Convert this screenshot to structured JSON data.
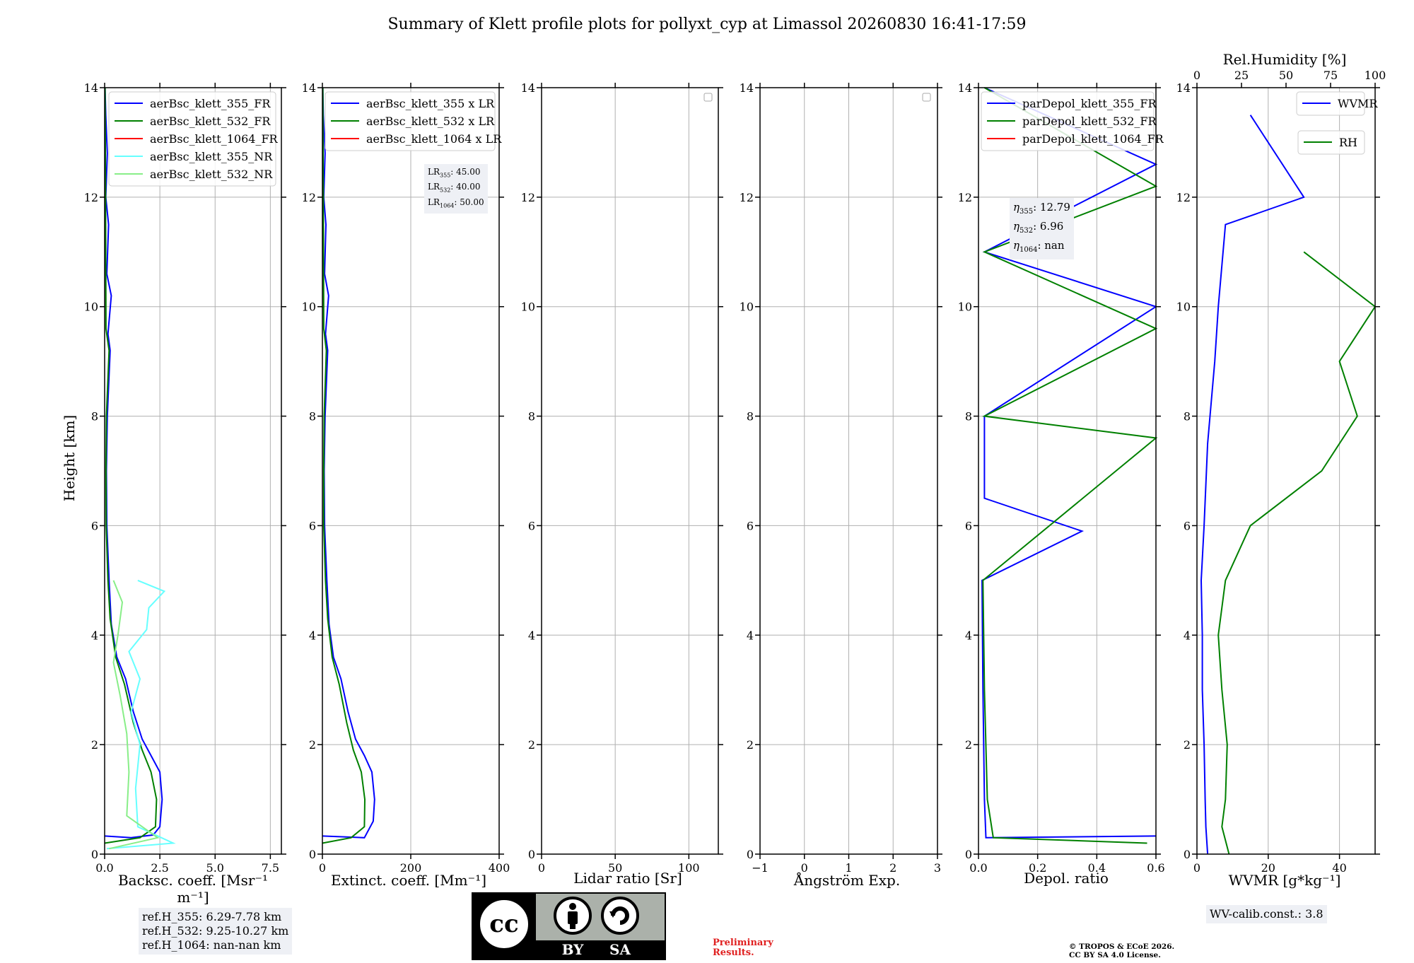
{
  "title": "Summary of Klett profile plots for pollyxt_cyp at Limassol 20260830 16:41-17:59",
  "ylabel": "Height [km]",
  "yticks": [
    "0",
    "2",
    "4",
    "6",
    "8",
    "10",
    "12",
    "14"
  ],
  "ylim": [
    0,
    14
  ],
  "colors": {
    "c355": "#0000ff",
    "c532": "#008000",
    "c1064": "#ff0000",
    "c355nr": "#66ffff",
    "c532nr": "#88ee88"
  },
  "panels": {
    "backscatter": {
      "xlabel": "Backsc. coeff. [Msr⁻¹ m⁻¹]",
      "xticks": [
        "0.0",
        "2.5",
        "5.0",
        "7.5"
      ],
      "xlim": [
        0,
        8
      ],
      "legend": [
        "aerBsc_klett_355_FR",
        "aerBsc_klett_532_FR",
        "aerBsc_klett_1064_FR",
        "aerBsc_klett_355_NR",
        "aerBsc_klett_532_NR"
      ]
    },
    "extinction": {
      "xlabel": "Extinct. coeff. [Mm⁻¹]",
      "xticks": [
        "0",
        "200",
        "400"
      ],
      "xlim": [
        0,
        400
      ],
      "legend": [
        "aerBsc_klett_355 x LR",
        "aerBsc_klett_532 x LR",
        "aerBsc_klett_1064 x LR"
      ],
      "lr_text": [
        "LR355: 45.00",
        "LR532: 40.00",
        "LR1064: 50.00"
      ]
    },
    "lidar_ratio": {
      "xlabel": "Lidar ratio [Sr]",
      "xticks": [
        "0",
        "50",
        "100"
      ],
      "xlim": [
        0,
        120
      ]
    },
    "angstrom": {
      "xlabel": "Ångström Exp.",
      "xticks": [
        "−1",
        "0",
        "1",
        "2",
        "3"
      ],
      "xlim": [
        -1,
        3
      ]
    },
    "depol": {
      "xlabel": "Depol. ratio",
      "xticks": [
        "0.0",
        "0.2",
        "0.4",
        "0.6"
      ],
      "xlim": [
        0,
        0.6
      ],
      "legend": [
        "parDepol_klett_355_FR",
        "parDepol_klett_532_FR",
        "parDepol_klett_1064_FR"
      ],
      "eta_text": [
        "η355: 12.79",
        "η532: 6.96",
        "η1064: nan"
      ]
    },
    "wvmr": {
      "xlabel": "WVMR [g*kg⁻¹]",
      "xticks": [
        "0",
        "20",
        "40"
      ],
      "xlim": [
        0,
        50
      ],
      "top_label": "Rel.Humidity [%]",
      "top_ticks": [
        "0",
        "25",
        "50",
        "75",
        "100"
      ],
      "top_lim": [
        0,
        100
      ],
      "legend_wvmr": "WVMR",
      "legend_rh": "RH"
    }
  },
  "ref_heights": [
    "ref.H_355: 6.29-7.78 km",
    "ref.H_532: 9.25-10.27 km",
    "ref.H_1064: nan-nan km"
  ],
  "wv_calib": "WV-calib.const.: 3.8",
  "preliminary": [
    "Preliminary",
    "Results."
  ],
  "copyright": [
    "© TROPOS & ECoE 2026.",
    "CC BY SA 4.0 License."
  ],
  "license_badge": {
    "by": "BY",
    "sa": "SA"
  },
  "chart_data": {
    "type": "line",
    "title": "Summary of Klett profile plots for pollyxt_cyp at Limassol 20260830 16:41-17:59",
    "ylabel": "Height [km]",
    "ylim": [
      0,
      14
    ],
    "grid": true,
    "profiles": {
      "backscatter": {
        "xlim": [
          0,
          8
        ],
        "series": [
          {
            "name": "aerBsc_klett_355_FR",
            "color": "#0000ff",
            "points": [
              [
                0,
                0.33
              ],
              [
                1.2,
                0.3
              ],
              [
                2.2,
                0.35
              ],
              [
                2.5,
                0.5
              ],
              [
                2.6,
                1.0
              ],
              [
                2.5,
                1.5
              ],
              [
                2.1,
                1.8
              ],
              [
                1.7,
                2.1
              ],
              [
                1.3,
                2.6
              ],
              [
                0.95,
                3.2
              ],
              [
                0.55,
                3.6
              ],
              [
                0.3,
                4.2
              ],
              [
                0.2,
                5
              ],
              [
                0.1,
                6
              ],
              [
                0.08,
                7
              ],
              [
                0.12,
                8
              ],
              [
                0.25,
                9.2
              ],
              [
                0.15,
                9.5
              ],
              [
                0.3,
                10.2
              ],
              [
                0.1,
                10.6
              ],
              [
                0.18,
                11.5
              ],
              [
                0.05,
                12
              ],
              [
                0.12,
                12.8
              ],
              [
                0.05,
                13.5
              ],
              [
                0.02,
                14
              ]
            ]
          },
          {
            "name": "aerBsc_klett_532_FR",
            "color": "#008000",
            "points": [
              [
                0,
                0.2
              ],
              [
                1.6,
                0.3
              ],
              [
                2.3,
                0.5
              ],
              [
                2.35,
                1.0
              ],
              [
                2.1,
                1.5
              ],
              [
                1.7,
                1.9
              ],
              [
                1.3,
                2.4
              ],
              [
                0.9,
                3.1
              ],
              [
                0.5,
                3.6
              ],
              [
                0.25,
                4.3
              ],
              [
                0.15,
                5
              ],
              [
                0.07,
                6
              ],
              [
                0.06,
                7
              ],
              [
                0.08,
                8
              ],
              [
                0.2,
                9.2
              ],
              [
                0.06,
                9.6
              ],
              [
                0.04,
                12
              ],
              [
                0.02,
                14
              ]
            ]
          },
          {
            "name": "aerBsc_klett_355_NR",
            "color": "#66ffff",
            "points": [
              [
                0.1,
                0.1
              ],
              [
                3.1,
                0.2
              ],
              [
                1.5,
                0.5
              ],
              [
                1.4,
                1.2
              ],
              [
                1.6,
                2.0
              ],
              [
                1.2,
                2.6
              ],
              [
                1.6,
                3.2
              ],
              [
                1.1,
                3.7
              ],
              [
                1.9,
                4.1
              ],
              [
                2.0,
                4.5
              ],
              [
                2.7,
                4.8
              ],
              [
                1.5,
                5.0
              ]
            ]
          },
          {
            "name": "aerBsc_klett_532_NR",
            "color": "#88ee88",
            "points": [
              [
                0.2,
                0.1
              ],
              [
                2.4,
                0.3
              ],
              [
                1.0,
                0.7
              ],
              [
                1.1,
                1.5
              ],
              [
                1.0,
                2.2
              ],
              [
                0.7,
                2.9
              ],
              [
                0.4,
                3.5
              ],
              [
                0.6,
                4.0
              ],
              [
                0.8,
                4.6
              ],
              [
                0.4,
                5.0
              ]
            ]
          }
        ]
      },
      "extinction": {
        "xlim": [
          0,
          400
        ],
        "series": [
          {
            "name": "aerBsc_klett_355 x LR",
            "color": "#0000ff",
            "points": [
              [
                0,
                0.33
              ],
              [
                95,
                0.3
              ],
              [
                115,
                0.6
              ],
              [
                118,
                1.0
              ],
              [
                112,
                1.5
              ],
              [
                95,
                1.8
              ],
              [
                75,
                2.1
              ],
              [
                58,
                2.6
              ],
              [
                42,
                3.2
              ],
              [
                25,
                3.6
              ],
              [
                15,
                4.2
              ],
              [
                10,
                5
              ],
              [
                5,
                6
              ],
              [
                4,
                7
              ],
              [
                6,
                8
              ],
              [
                12,
                9.2
              ],
              [
                7,
                9.5
              ],
              [
                14,
                10.2
              ],
              [
                5,
                10.6
              ],
              [
                8,
                11.5
              ],
              [
                3,
                12
              ],
              [
                6,
                12.8
              ],
              [
                2,
                13.5
              ],
              [
                1,
                14
              ]
            ]
          },
          {
            "name": "aerBsc_klett_532 x LR",
            "color": "#008000",
            "points": [
              [
                0,
                0.2
              ],
              [
                65,
                0.3
              ],
              [
                95,
                0.5
              ],
              [
                96,
                1.0
              ],
              [
                88,
                1.5
              ],
              [
                70,
                1.9
              ],
              [
                55,
                2.4
              ],
              [
                38,
                3.1
              ],
              [
                22,
                3.6
              ],
              [
                12,
                4.3
              ],
              [
                7,
                5
              ],
              [
                3,
                6
              ],
              [
                3,
                7
              ],
              [
                4,
                8
              ],
              [
                9,
                9.2
              ],
              [
                3,
                9.6
              ],
              [
                2,
                12
              ],
              [
                1,
                14
              ]
            ]
          }
        ]
      },
      "depol": {
        "xlim": [
          0,
          0.6
        ],
        "series": [
          {
            "name": "parDepol_klett_355_FR",
            "color": "#0000ff",
            "points": [
              [
                0.6,
                0.33
              ],
              [
                0.025,
                0.3
              ],
              [
                0.02,
                1.0
              ],
              [
                0.015,
                3.0
              ],
              [
                0.012,
                5.0
              ],
              [
                0.35,
                5.9
              ],
              [
                0.02,
                6.5
              ],
              [
                0.02,
                8.0
              ],
              [
                0.6,
                10.0
              ],
              [
                0.02,
                11.0
              ],
              [
                0.6,
                12.6
              ],
              [
                0.02,
                14.0
              ]
            ]
          },
          {
            "name": "parDepol_klett_532_FR",
            "color": "#008000",
            "points": [
              [
                0.57,
                0.2
              ],
              [
                0.05,
                0.3
              ],
              [
                0.03,
                1.0
              ],
              [
                0.02,
                3.0
              ],
              [
                0.015,
                5.0
              ],
              [
                0.6,
                7.6
              ],
              [
                0.02,
                8.0
              ],
              [
                0.6,
                9.6
              ],
              [
                0.02,
                11.0
              ],
              [
                0.6,
                12.2
              ],
              [
                0.02,
                14.0
              ]
            ]
          }
        ]
      },
      "wvmr": {
        "xlim": [
          0,
          50
        ],
        "series": [
          {
            "name": "WVMR",
            "color": "#0000ff",
            "points": [
              [
                3,
                0
              ],
              [
                2.5,
                0.5
              ],
              [
                2.3,
                1.0
              ],
              [
                2.0,
                2.0
              ],
              [
                1.5,
                3.0
              ],
              [
                1.5,
                4.0
              ],
              [
                1.2,
                5.0
              ],
              [
                2.0,
                6.0
              ],
              [
                3,
                7.5
              ],
              [
                5,
                9.0
              ],
              [
                6,
                10.0
              ],
              [
                8,
                11.5
              ],
              [
                30,
                12.0
              ],
              [
                15,
                13.5
              ]
            ]
          },
          {
            "name": "RH",
            "axis": "top",
            "color": "#008000",
            "points": [
              [
                18,
                0
              ],
              [
                14,
                0.5
              ],
              [
                16,
                1.0
              ],
              [
                17,
                2.0
              ],
              [
                14,
                3.0
              ],
              [
                12,
                4.0
              ],
              [
                16,
                5.0
              ],
              [
                30,
                6.0
              ],
              [
                70,
                7.0
              ],
              [
                90,
                8.0
              ],
              [
                80,
                9.0
              ],
              [
                100,
                10.0
              ],
              [
                60,
                11.0
              ]
            ]
          }
        ]
      },
      "lidar_ratio": {
        "xlim": [
          0,
          120
        ],
        "series": []
      },
      "angstrom": {
        "xlim": [
          -1,
          3
        ],
        "series": []
      }
    },
    "annotations": {
      "LR": {
        "355": 45.0,
        "532": 40.0,
        "1064": 50.0
      },
      "eta": {
        "355": 12.79,
        "532": 6.96,
        "1064": "nan"
      },
      "wv_calib_const": 3.8
    }
  }
}
